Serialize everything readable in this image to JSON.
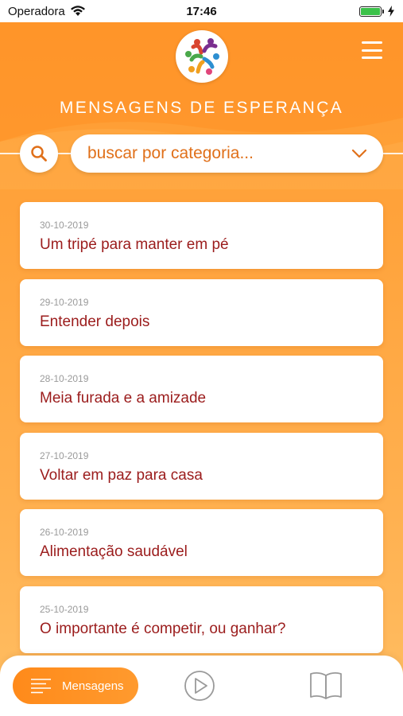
{
  "status_bar": {
    "carrier": "Operadora",
    "time": "17:46",
    "battery_level": 1.0,
    "battery_color": "#3cc24a"
  },
  "header": {
    "title": "MENSAGENS DE ESPERANÇA",
    "logo_icon": "community-people-logo",
    "menu_icon": "hamburger-menu-icon"
  },
  "search": {
    "icon": "search-icon",
    "category_placeholder": "buscar por categoria...",
    "dropdown_icon": "chevron-down-icon"
  },
  "messages": [
    {
      "date": "30-10-2019",
      "title": "Um tripé para manter em pé"
    },
    {
      "date": "29-10-2019",
      "title": "Entender depois"
    },
    {
      "date": "28-10-2019",
      "title": "Meia furada e a amizade"
    },
    {
      "date": "27-10-2019",
      "title": "Voltar em paz para casa"
    },
    {
      "date": "26-10-2019",
      "title": "Alimentação saudável"
    },
    {
      "date": "25-10-2019",
      "title": "O importante é competir, ou ganhar?"
    }
  ],
  "tab_bar": {
    "messages_label": "Mensagens",
    "messages_icon": "list-icon",
    "play_icon": "play-circle-icon",
    "book_icon": "open-book-icon"
  },
  "colors": {
    "accent": "#ff9a2e",
    "title_text": "#9b1c1c",
    "date_text": "#9a9a9a",
    "category_text": "#e0701a"
  }
}
